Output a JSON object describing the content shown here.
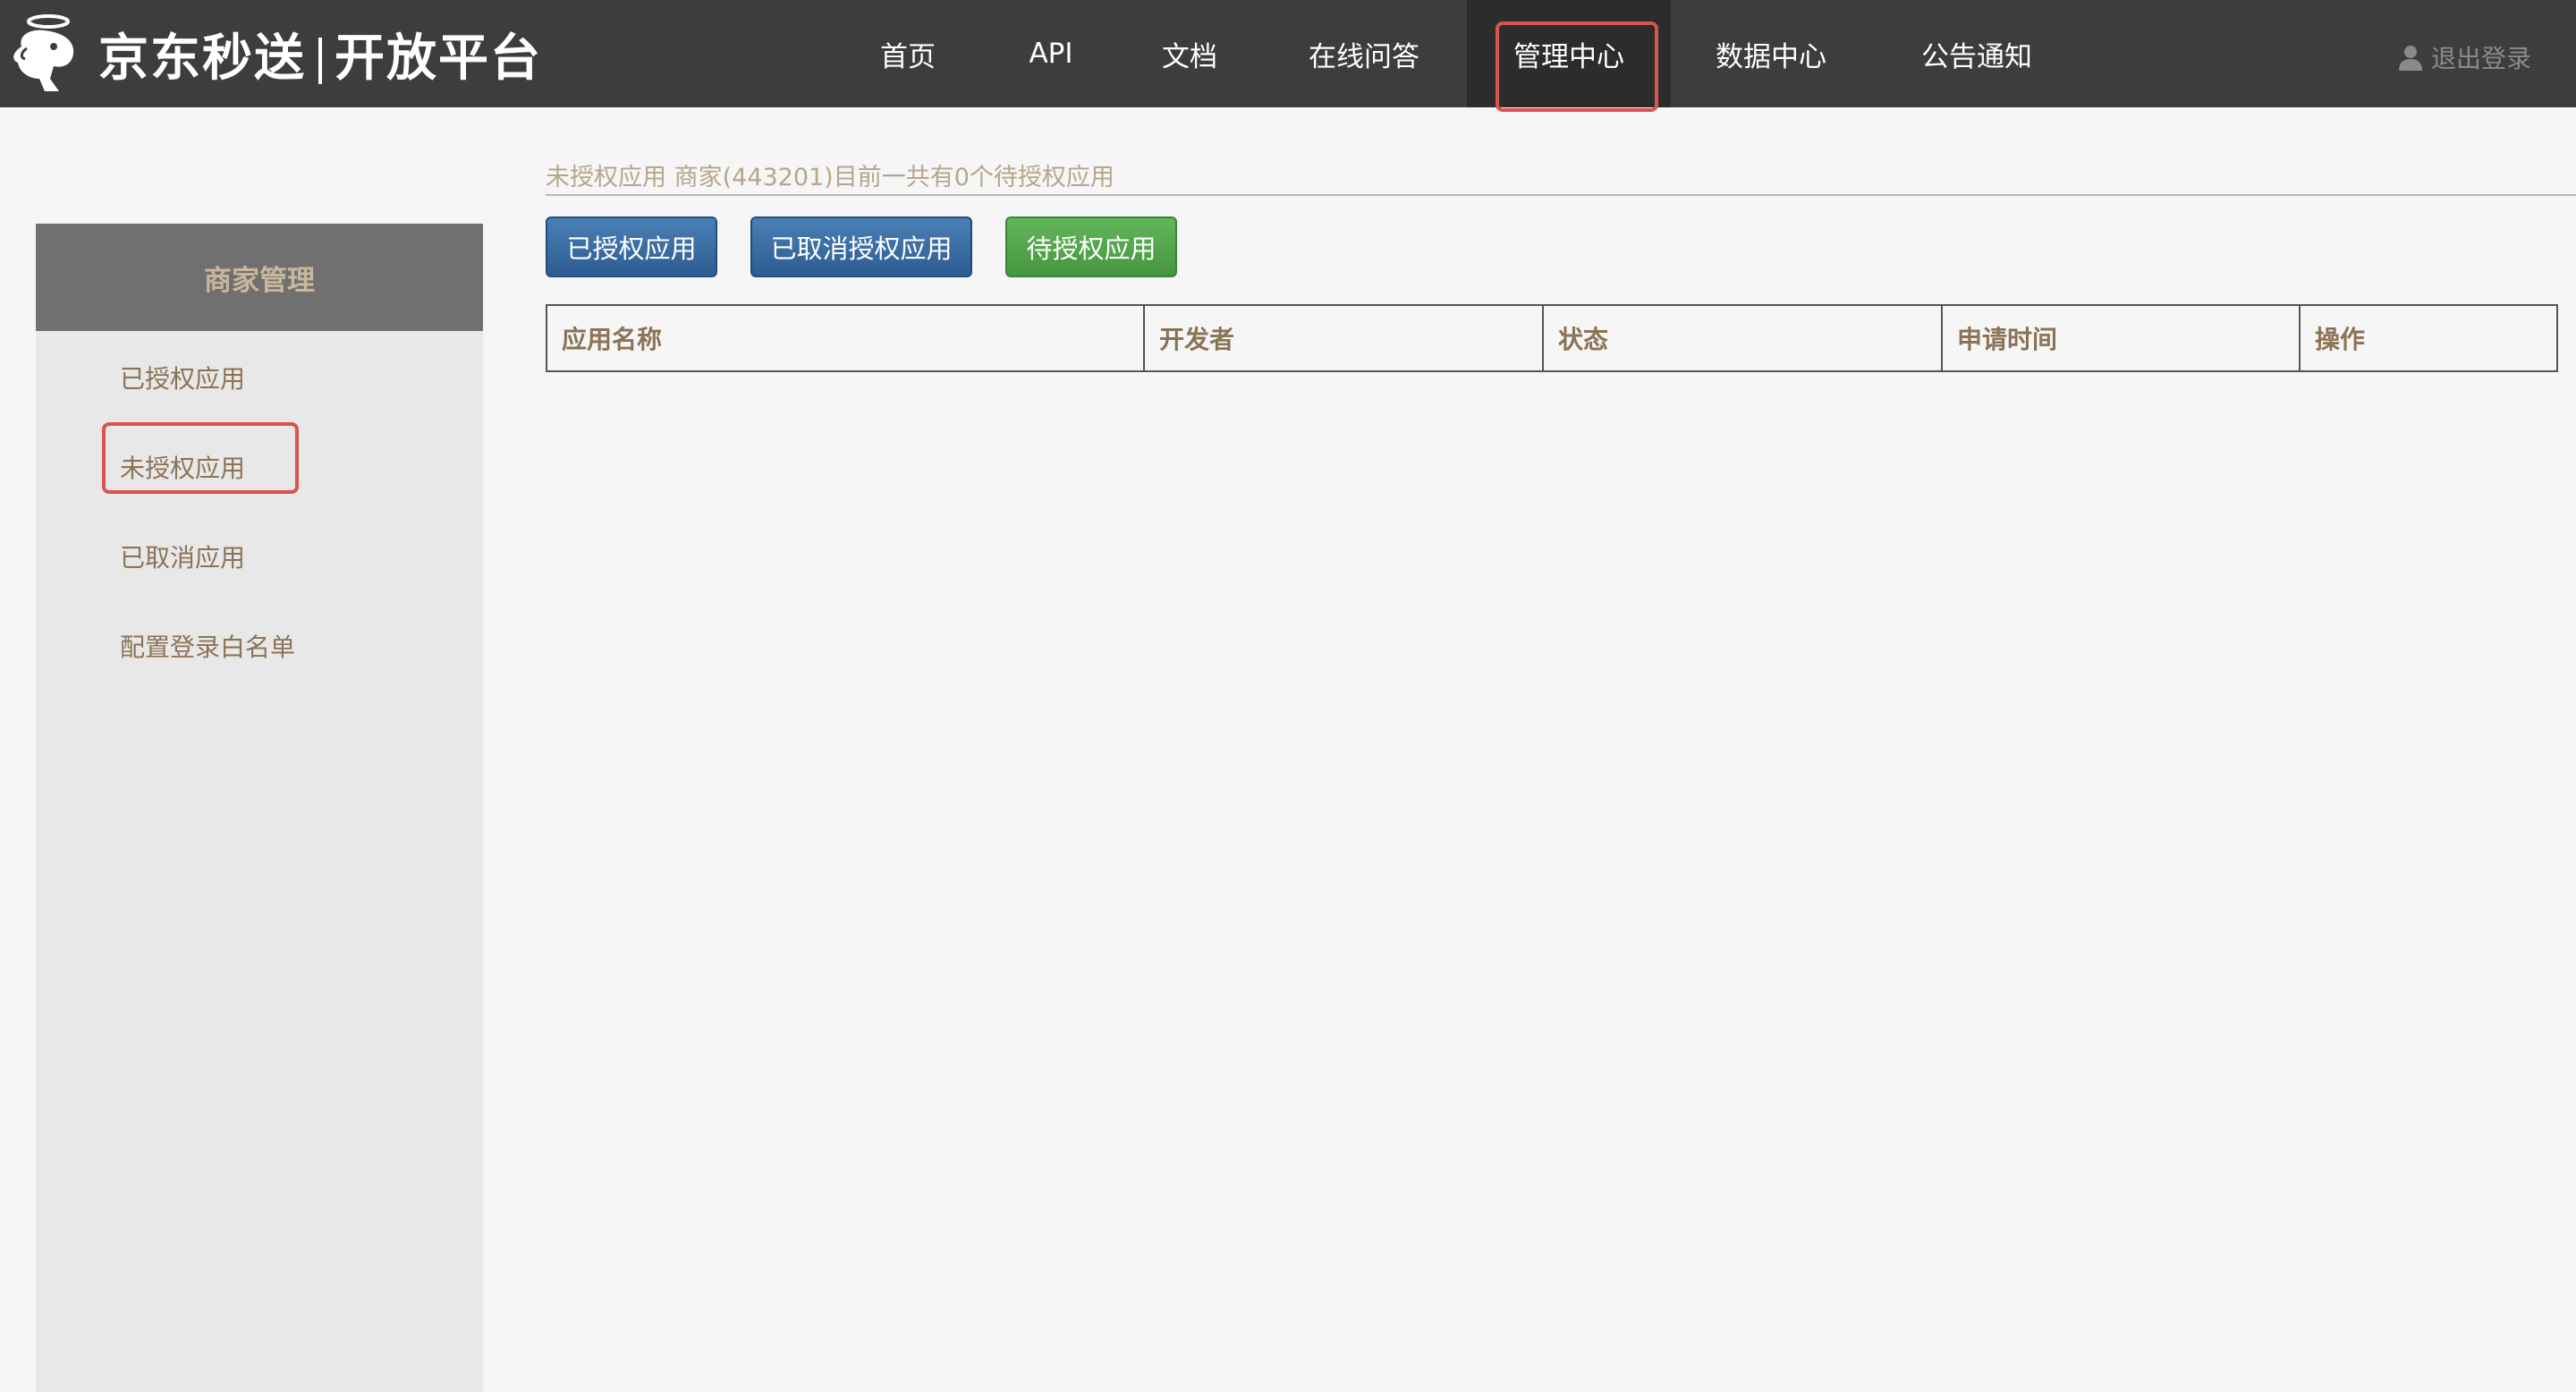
{
  "header": {
    "logo_text_left": "京东秒送",
    "logo_text_right": "开放平台",
    "nav": [
      {
        "label": "首页"
      },
      {
        "label": "API"
      },
      {
        "label": "文档"
      },
      {
        "label": "在线问答"
      },
      {
        "label": "管理中心",
        "active": true
      },
      {
        "label": "数据中心"
      },
      {
        "label": "公告通知"
      }
    ],
    "logout_label": "退出登录",
    "logout_icon": "user-icon"
  },
  "sidebar": {
    "title": "商家管理",
    "items": [
      {
        "label": "已授权应用"
      },
      {
        "label": "未授权应用",
        "active": true
      },
      {
        "label": "已取消应用"
      },
      {
        "label": "配置登录白名单"
      }
    ]
  },
  "main": {
    "summary": "未授权应用 商家(443201)目前一共有0个待授权应用",
    "buttons": [
      {
        "label": "已授权应用",
        "color": "#2d5d92"
      },
      {
        "label": "已取消授权应用",
        "color": "#2d5d92"
      },
      {
        "label": "待授权应用",
        "color": "#46963f"
      }
    ],
    "table": {
      "columns": [
        "应用名称",
        "开发者",
        "状态",
        "申请时间",
        "操作"
      ],
      "rows": []
    }
  },
  "colors": {
    "topbar": "#3d3d3d",
    "highlight": "#d9534f",
    "sidebar_text": "#8b7356"
  }
}
